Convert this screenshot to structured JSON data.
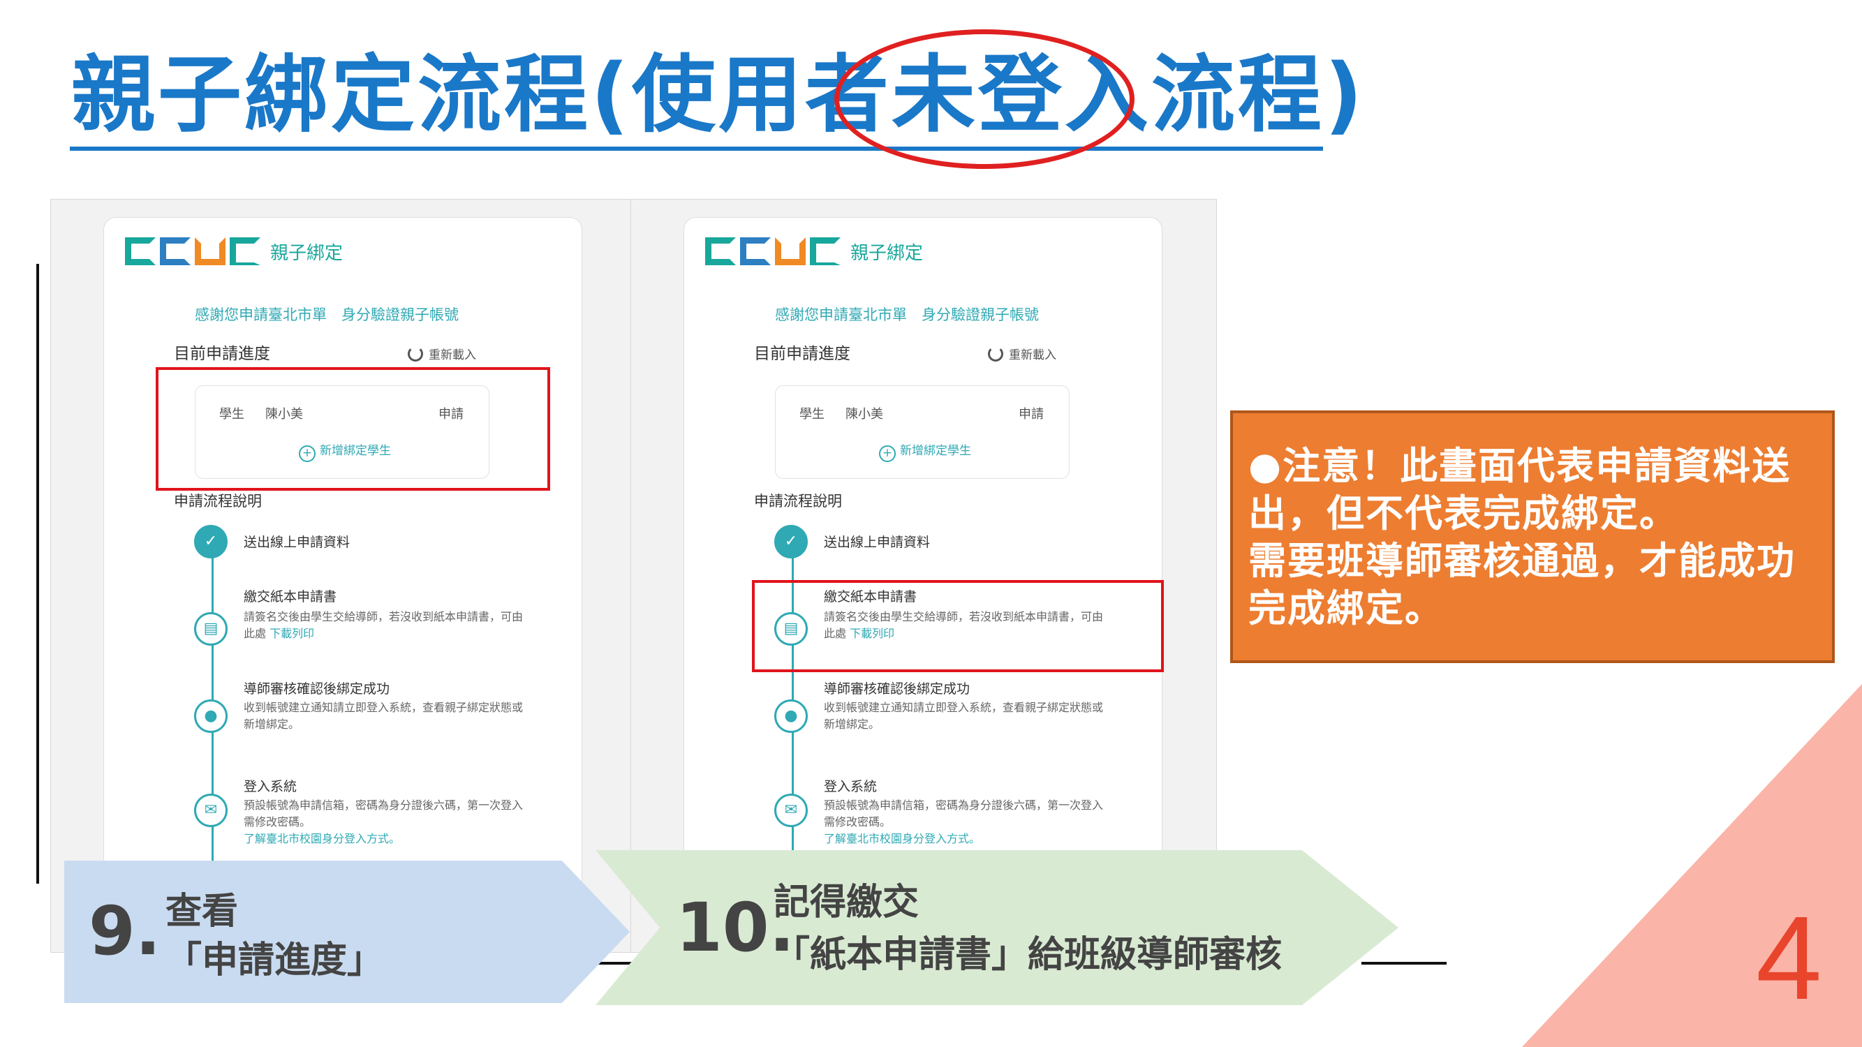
{
  "slide": {
    "title": "親子綁定流程(使用者未登入流程)",
    "page_number": "4"
  },
  "app": {
    "logo_text": "CGGC",
    "title": "親子綁定",
    "intro": "感謝您申請臺北市單　身分驗證親子帳號",
    "progress_label": "目前申請進度",
    "reload_label": "重新載入",
    "student": {
      "role": "學生",
      "name": "陳小美",
      "status": "申請"
    },
    "add_student": "新增綁定學生",
    "flow_label": "申請流程說明",
    "steps": [
      {
        "title": "送出線上申請資料"
      },
      {
        "title": "繳交紙本申請書",
        "desc": "請簽名交後由學生交給導師，若沒收到紙本申請書，可由此處",
        "link": "下載列印"
      },
      {
        "title": "導師審核確認後綁定成功",
        "desc": "收到帳號建立通知請立即登入系統，查看親子綁定狀態或新增綁定。"
      },
      {
        "title": "登入系統",
        "desc": "預設帳號為申請信箱，密碼為身分證後六碼，第一次登入需修改密碼。",
        "link": "了解臺北市校園身分登入方式。"
      }
    ]
  },
  "note": {
    "line1": "●注意！此畫面代表申請資料送出，但不代表完成綁定。",
    "line2": "需要班導師審核通過，才能成功完成綁定。"
  },
  "arrows": {
    "step9": {
      "number": "9.",
      "line1": "查看",
      "line2": "「申請進度」"
    },
    "step10": {
      "number": "10.",
      "line1": "記得繳交",
      "line2": "「紙本申請書」給班級導師審核"
    }
  },
  "colors": {
    "title_blue": "#1a78c8",
    "highlight_red": "#e0141c",
    "teal": "#2fa9b4",
    "note_orange": "#ed7d31",
    "arrow_blue": "#c9dbf0",
    "arrow_green": "#d9ead3"
  }
}
